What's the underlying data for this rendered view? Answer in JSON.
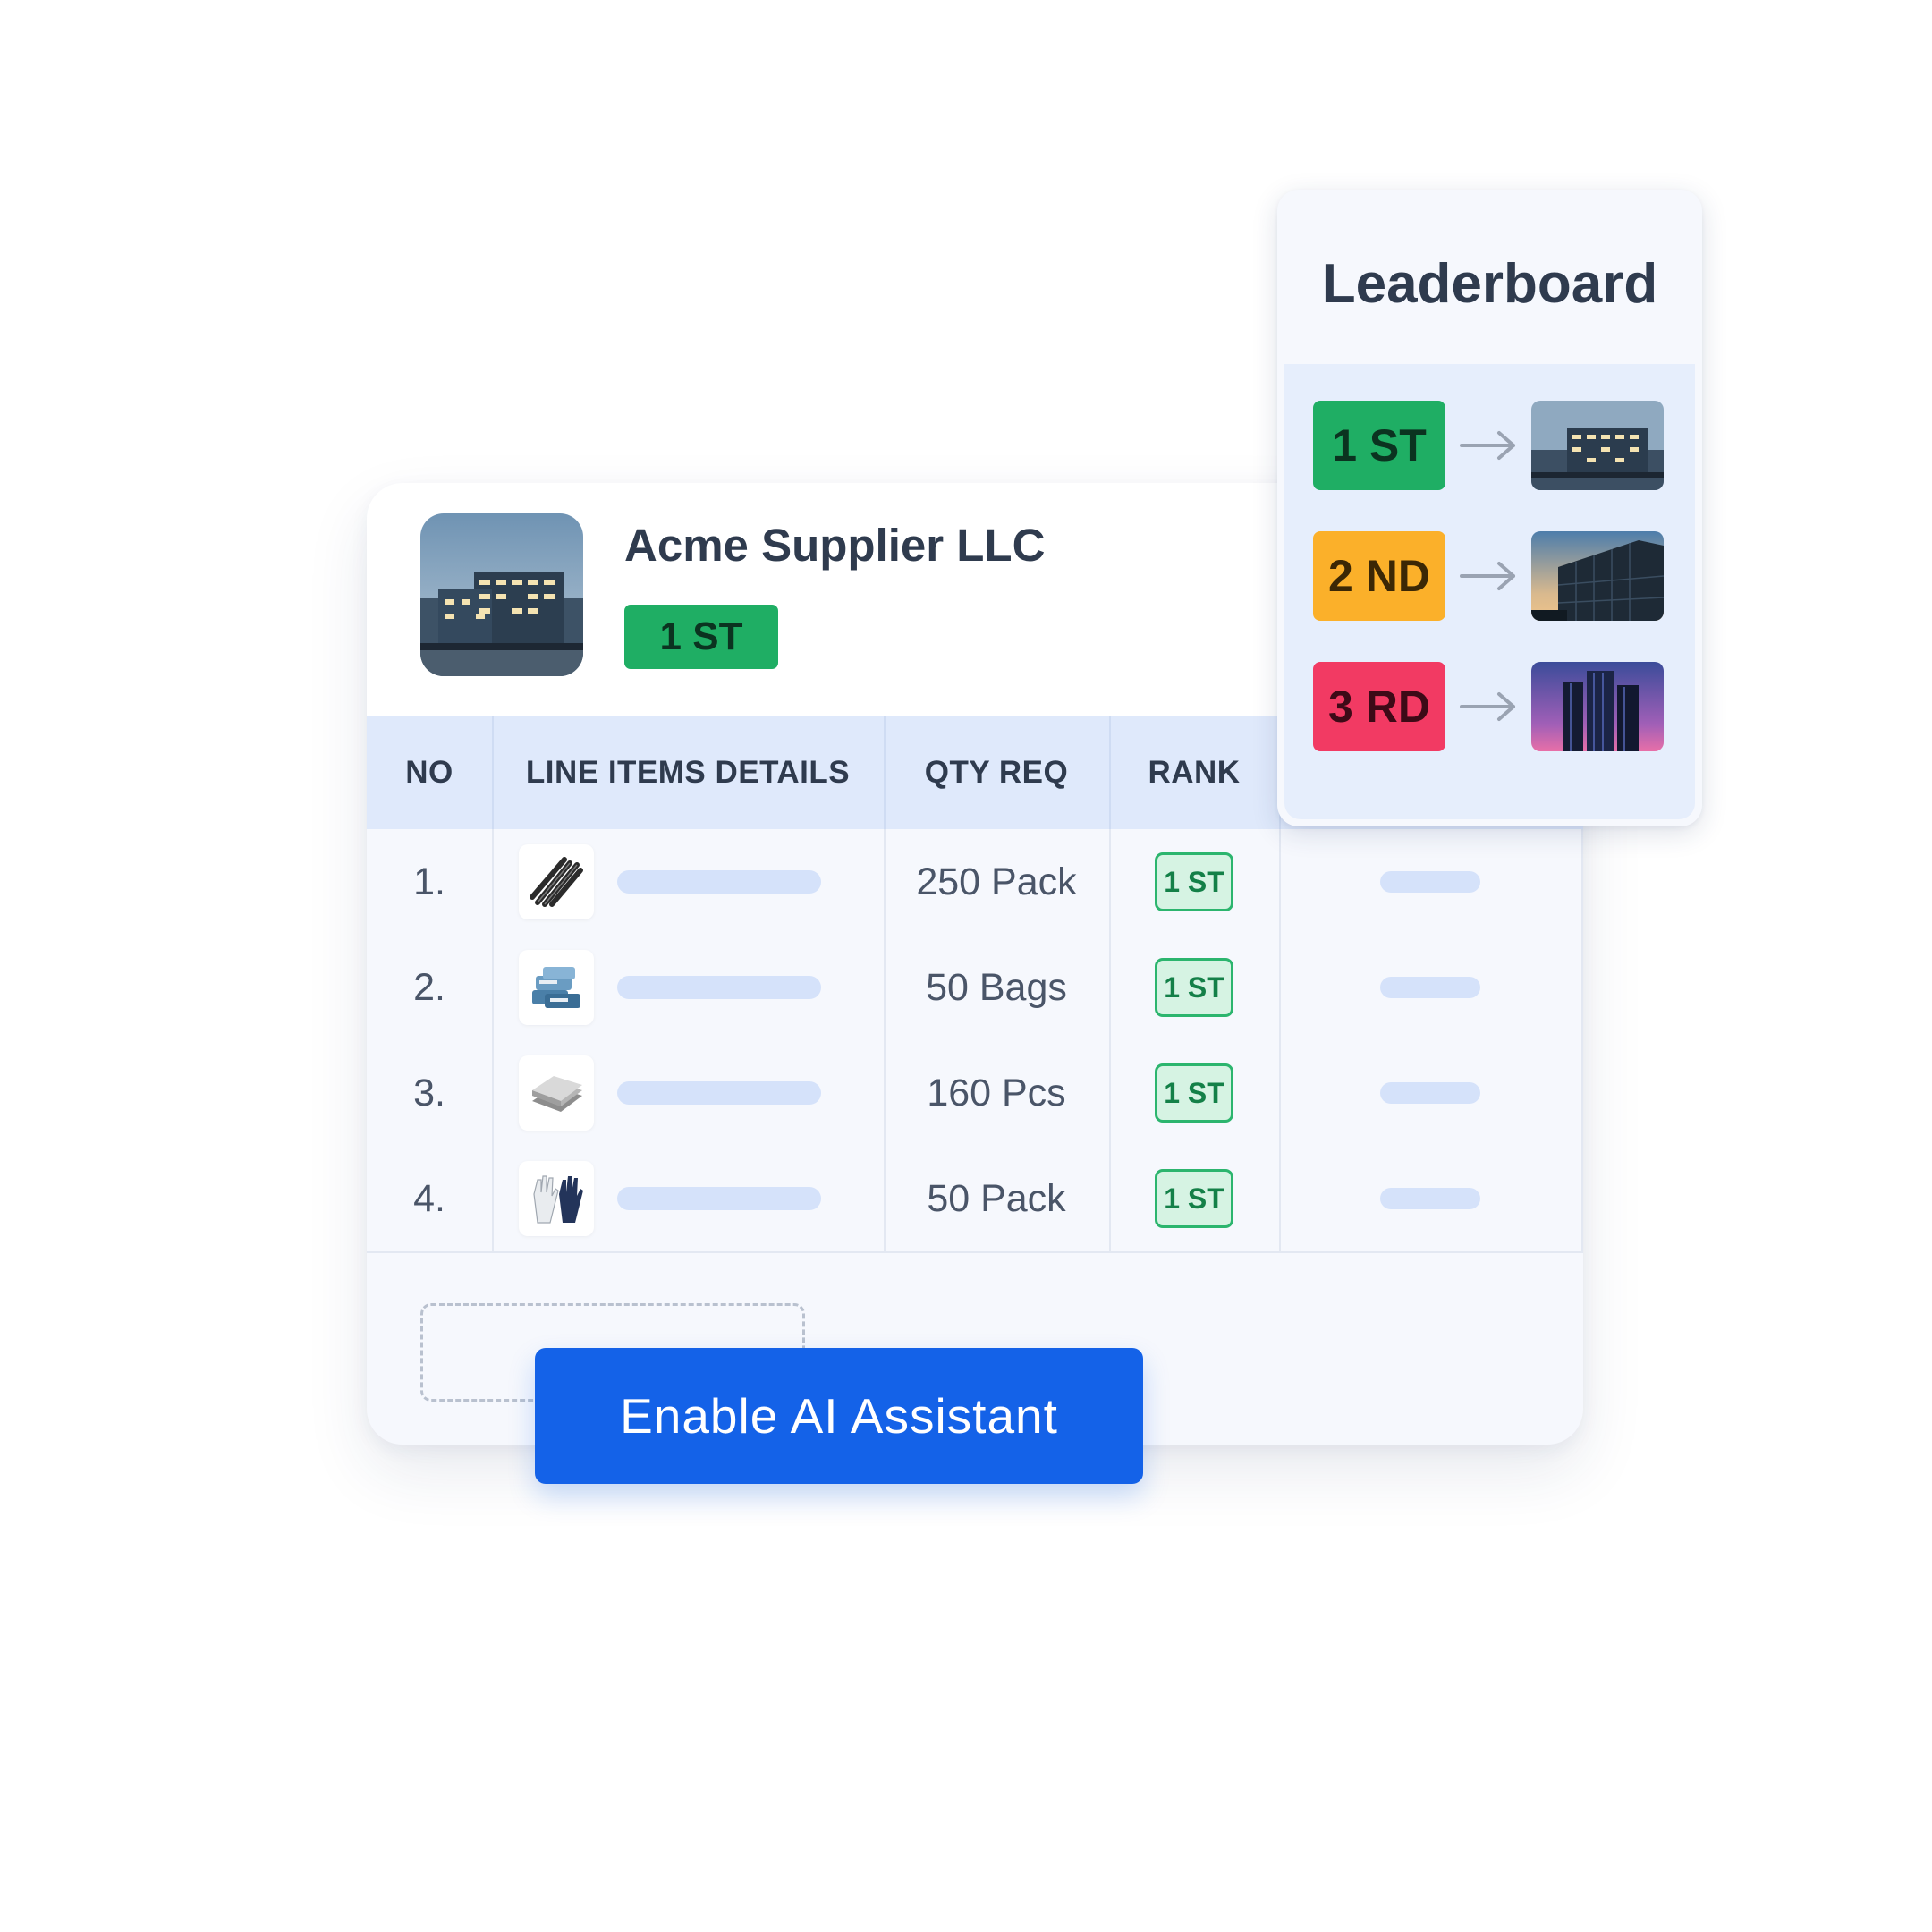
{
  "supplier": {
    "name": "Acme Supplier LLC",
    "rank_badge": "1 ST",
    "rank_color": "#1fae64"
  },
  "table": {
    "headers": [
      "NO",
      "LINE ITEMS DETAILS",
      "QTY REQ",
      "RANK"
    ],
    "rows": [
      {
        "no": "1.",
        "icon": "steel-rods-icon",
        "qty": "250 Pack",
        "rank": "1 ST"
      },
      {
        "no": "2.",
        "icon": "cement-bags-icon",
        "qty": "50 Bags",
        "rank": "1 ST"
      },
      {
        "no": "3.",
        "icon": "sheet-stack-icon",
        "qty": "160 Pcs",
        "rank": "1 ST"
      },
      {
        "no": "4.",
        "icon": "work-gloves-icon",
        "qty": "50 Pack",
        "rank": "1 ST"
      }
    ]
  },
  "ai_button": {
    "label": "Enable AI Assistant",
    "color": "#1462e8"
  },
  "leaderboard": {
    "title": "Leaderboard",
    "entries": [
      {
        "label": "1 ST",
        "color": "#1fae64",
        "icon": "office-building-icon"
      },
      {
        "label": "2 ND",
        "color": "#fbb02a",
        "icon": "glass-building-icon"
      },
      {
        "label": "3 RD",
        "color": "#f23a63",
        "icon": "tower-building-icon"
      }
    ]
  }
}
